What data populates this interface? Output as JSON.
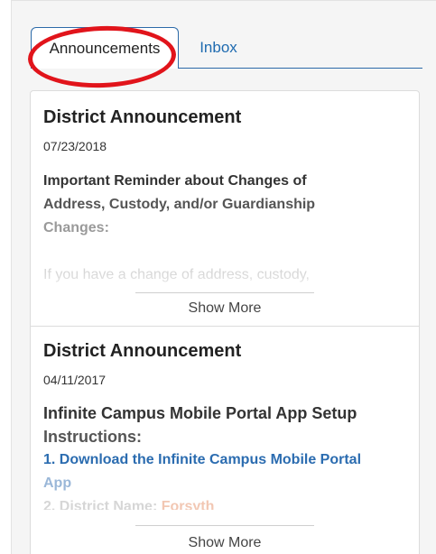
{
  "tabs": {
    "active": "Announcements",
    "inbox": "Inbox"
  },
  "announcements": [
    {
      "title": "District Announcement",
      "date": "07/23/2018",
      "line1": "Important Reminder about Changes of",
      "line2": "Address, Custody, and/or Guardianship",
      "line3": "Changes:",
      "line4": "If you have a change of address, custody,",
      "show_more": "Show More"
    },
    {
      "title": "District Announcement",
      "date": "04/11/2017",
      "line1": "Infinite Campus Mobile Portal App Setup",
      "line2": "Instructions:",
      "step1": "1.  Download the Infinite Campus Mobile Portal",
      "step1b": "App",
      "step2_label": "2.  District Name:",
      "step2_value": "Forsyth",
      "show_more": "Show More"
    }
  ],
  "colors": {
    "accent": "#2c6aa8",
    "highlight": "#e1141b"
  }
}
